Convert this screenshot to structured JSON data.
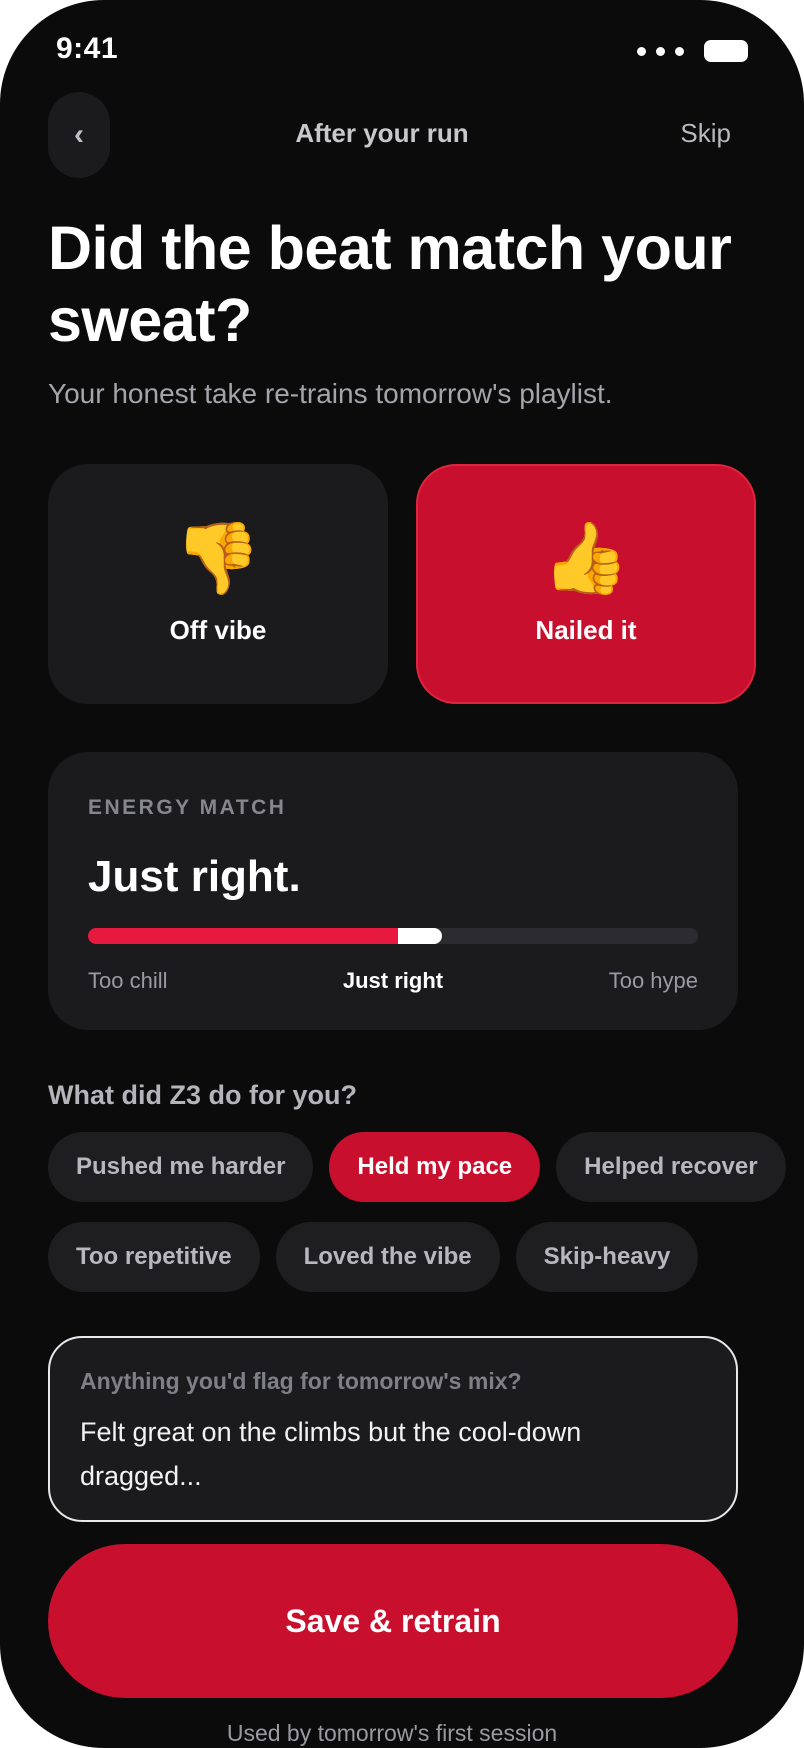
{
  "status_bar": {
    "time": "9:41"
  },
  "nav": {
    "back_glyph": "‹",
    "title": "After your run",
    "skip_label": "Skip"
  },
  "heading": {
    "title": "Did the beat match your sweat?",
    "subtitle": "Your honest take re-trains tomorrow's playlist."
  },
  "vote": {
    "off": {
      "emoji": "👎",
      "label": "Off vibe",
      "icon": "thumbs-down-icon",
      "selected": false
    },
    "on": {
      "emoji": "👍",
      "label": "Nailed it",
      "icon": "thumbs-up-icon",
      "selected": true
    }
  },
  "energy": {
    "eyebrow": "ENERGY MATCH",
    "value_text": "Just right.",
    "level_percent": 58,
    "scale": {
      "low": "Too chill",
      "mid": "Just right",
      "high": "Too hype"
    }
  },
  "tags": {
    "question": "What did Z3 do for you?",
    "row1": [
      {
        "label": "Pushed me harder",
        "selected": false
      },
      {
        "label": "Held my pace",
        "selected": true
      },
      {
        "label": "Helped recover",
        "selected": false
      }
    ],
    "row2": [
      {
        "label": "Too repetitive",
        "selected": false
      },
      {
        "label": "Loved the vibe",
        "selected": false
      },
      {
        "label": "Skip-heavy",
        "selected": false
      }
    ]
  },
  "note": {
    "label": "Anything you'd flag for tomorrow's mix?",
    "value": "Felt great on the climbs but the cool-down dragged..."
  },
  "cta": {
    "label": "Save & retrain"
  },
  "footnote": "Used by tomorrow's first session",
  "colors": {
    "accent": "#c8102e",
    "background": "#0b0b0c",
    "card": "#1b1b1e"
  }
}
